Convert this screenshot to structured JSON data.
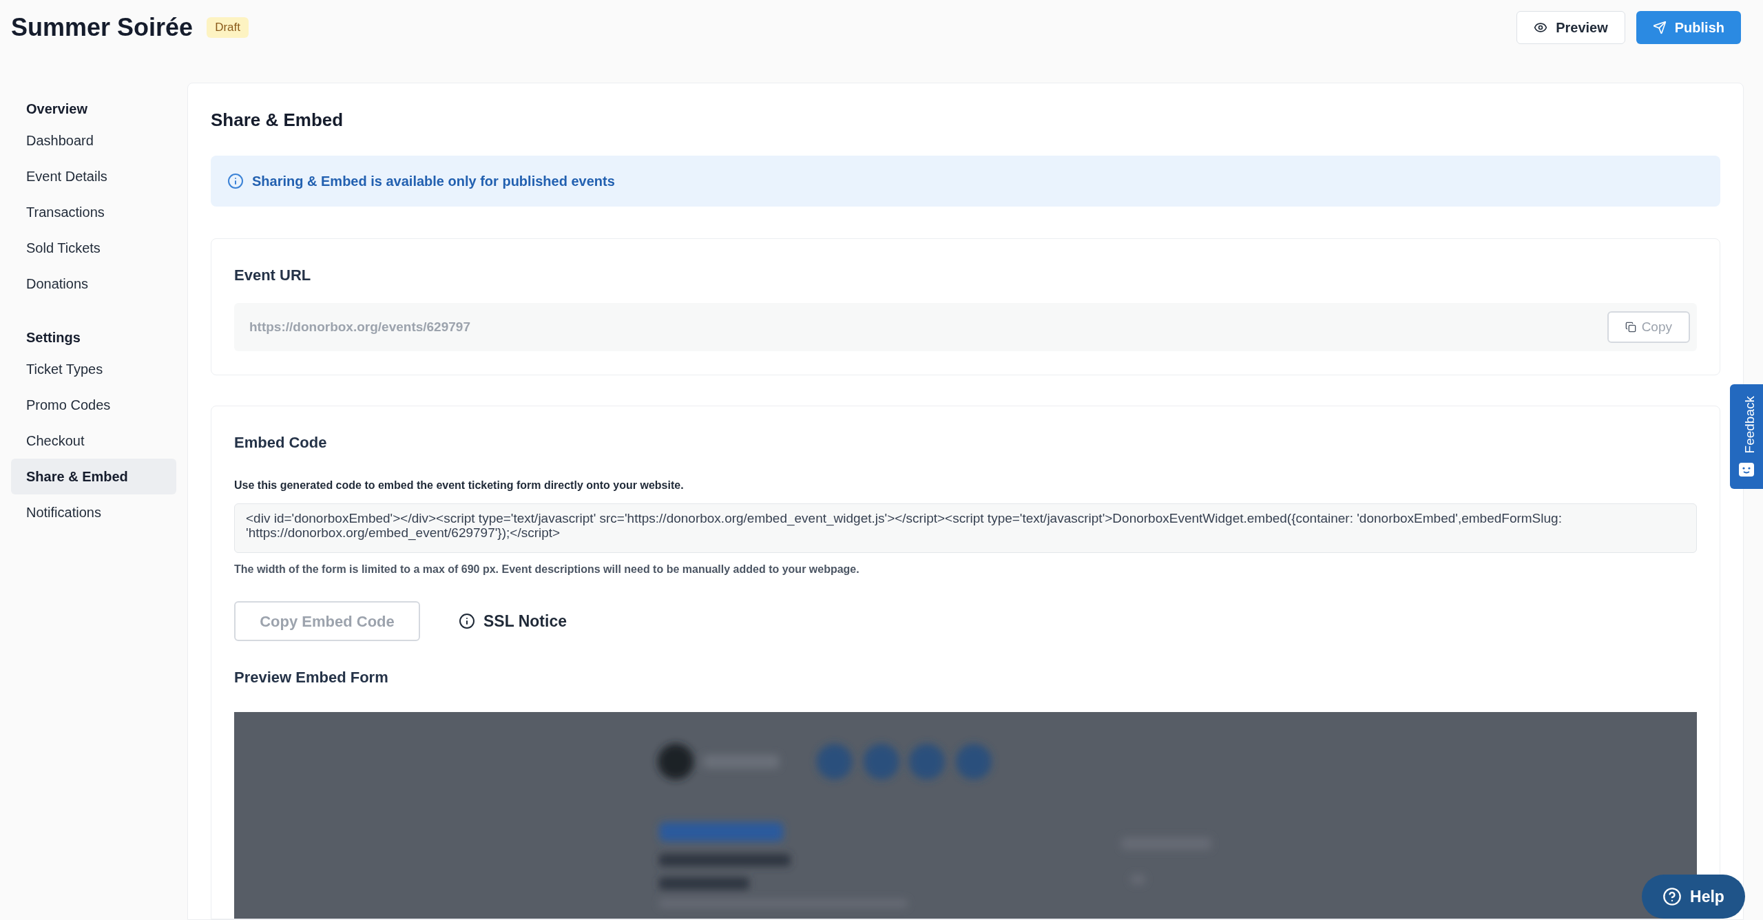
{
  "header": {
    "title": "Summer Soirée",
    "status_badge": "Draft",
    "buttons": [
      {
        "kind": "secondary",
        "label": "Preview"
      },
      {
        "kind": "primary",
        "label": "Publish"
      }
    ]
  },
  "sidebar": {
    "sections": [
      {
        "heading": "Overview",
        "items": [
          {
            "label": "Dashboard",
            "selected": false
          },
          {
            "label": "Event Details",
            "selected": false
          },
          {
            "label": "Transactions",
            "selected": false
          },
          {
            "label": "Sold Tickets",
            "selected": false
          },
          {
            "label": "Donations",
            "selected": false
          }
        ]
      },
      {
        "heading": "Settings",
        "items": [
          {
            "label": "Ticket Types",
            "selected": false
          },
          {
            "label": "Promo Codes",
            "selected": false
          },
          {
            "label": "Checkout",
            "selected": false
          },
          {
            "label": "Share & Embed",
            "selected": true
          },
          {
            "label": "Notifications",
            "selected": false
          }
        ]
      }
    ]
  },
  "main": {
    "title": "Share & Embed",
    "info_banner": "Sharing & Embed is available only for published events",
    "event_url": {
      "title": "Event URL",
      "value": "https://donorbox.org/events/629797",
      "copy_button": {
        "label": "Copy",
        "disabled": true
      }
    },
    "embed_code": {
      "title": "Embed Code",
      "description": "Use this generated code to embed the event ticketing form directly onto your website.",
      "code": "<div id='donorboxEmbed'></div><script type='text/javascript' src='https://donorbox.org/embed_event_widget.js'></script><script type='text/javascript'>DonorboxEventWidget.embed({container: 'donorboxEmbed',embedFormSlug: 'https://donorbox.org/embed_event/629797'});</script>",
      "note": "The width of the form is limited to a max of 690 px. Event descriptions will need to be manually added to your webpage.",
      "copy_button": {
        "label": "Copy Embed Code",
        "disabled": true
      },
      "ssl_notice": "SSL Notice",
      "preview_title": "Preview Embed Form"
    }
  },
  "feedback_tab": "Feedback",
  "help_button": "Help"
}
